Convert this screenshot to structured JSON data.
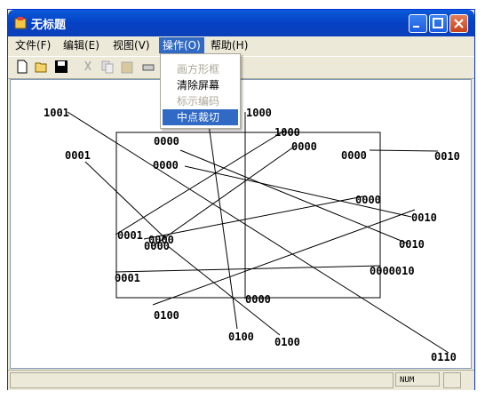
{
  "window": {
    "title": "无标题"
  },
  "menu": [
    {
      "label": "文件(F)"
    },
    {
      "label": "编辑(E)"
    },
    {
      "label": "视图(V)"
    },
    {
      "label": "操作(O)"
    },
    {
      "label": "帮助(H)"
    }
  ],
  "dropdown": [
    {
      "label": "画方形框",
      "state": "disabled"
    },
    {
      "label": "清除屏幕",
      "state": "normal"
    },
    {
      "label": "标示编码",
      "state": "disabled"
    },
    {
      "label": "中点裁切",
      "state": "selected"
    }
  ],
  "toolbar": [
    "new-file-icon",
    "open-folder-icon",
    "save-icon",
    "cut-icon",
    "copy-icon",
    "paste-icon",
    "print-icon"
  ],
  "canvas_labels": [
    {
      "text": "1001"
    },
    {
      "text": "0001"
    },
    {
      "text": "0000"
    },
    {
      "text": "1000"
    },
    {
      "text": "1000"
    },
    {
      "text": "0000"
    },
    {
      "text": "0000"
    },
    {
      "text": "0010"
    },
    {
      "text": "0000"
    },
    {
      "text": "0000"
    },
    {
      "text": "0010"
    },
    {
      "text": "0001"
    },
    {
      "text": "0000"
    },
    {
      "text": "0010"
    },
    {
      "text": "0000"
    },
    {
      "text": "0000010"
    },
    {
      "text": "0001"
    },
    {
      "text": "0000"
    },
    {
      "text": "0100"
    },
    {
      "text": "0100"
    },
    {
      "text": "0100"
    },
    {
      "text": "0110"
    }
  ],
  "status": {
    "num": "NUM"
  },
  "colors": {
    "title_bar": "#0a5ad9",
    "selection": "#316ac5",
    "chrome": "#ece9d8"
  }
}
